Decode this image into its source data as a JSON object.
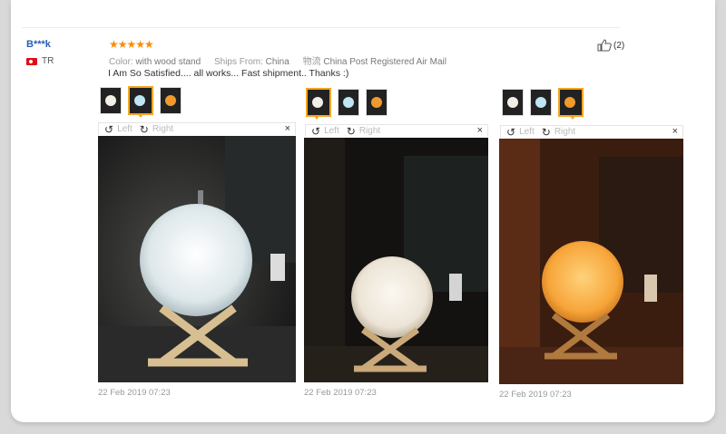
{
  "review": {
    "user": "B***k",
    "country": "TR",
    "rating_stars": "★★★★★",
    "color_label": "Color:",
    "color_value": "with wood stand",
    "ships_label": "Ships From:",
    "ships_value": "China",
    "shipping_label": "物流",
    "shipping_value": "China Post Registered Air Mail",
    "comment": "I Am So Satisfied.... all works... Fast shipment.. Thanks :)",
    "likes": "(2)"
  },
  "viewer": {
    "left_label": "Left",
    "right_label": "Right",
    "close_glyph": "×",
    "rotate_left_glyph": "↺",
    "rotate_right_glyph": "↻"
  },
  "photos": [
    {
      "date": "22 Feb 2019 07:23",
      "selected_thumb": 2,
      "glow": "#e8eef2"
    },
    {
      "date": "22 Feb 2019 07:23",
      "selected_thumb": 1,
      "glow": "#f2ede3"
    },
    {
      "date": "22 Feb 2019 07:23",
      "selected_thumb": 3,
      "glow": "#f7a53a"
    }
  ],
  "thumb_colors": [
    "#f3efe6",
    "#bfe6f5",
    "#f39a2c"
  ],
  "icons": {
    "like": "thumbs-up-icon",
    "rotate_left": "rotate-left-icon",
    "rotate_right": "rotate-right-icon",
    "close": "close-icon"
  }
}
